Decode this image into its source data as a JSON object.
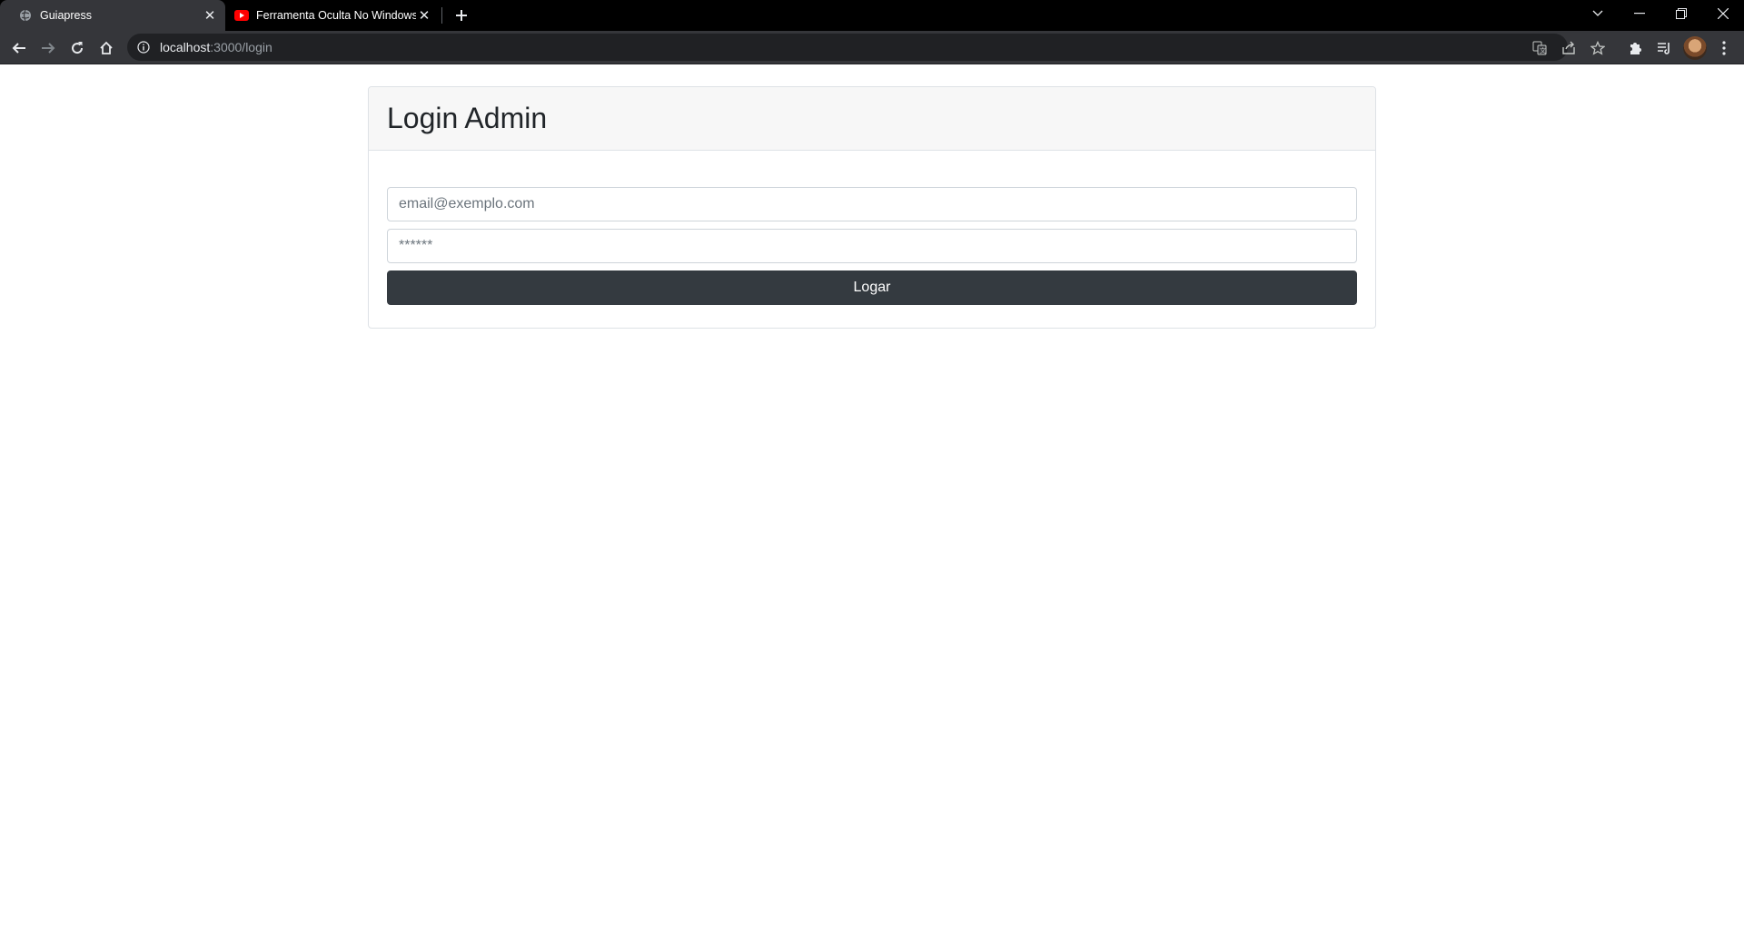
{
  "browser": {
    "tabs": [
      {
        "title": "Guiapress",
        "active": true,
        "favicon": "globe-icon"
      },
      {
        "title": "Ferramenta Oculta No Windows",
        "active": false,
        "favicon": "youtube-icon"
      }
    ],
    "address": {
      "host": "localhost",
      "path": ":3000/login"
    },
    "colors": {
      "tabstrip": "#000000",
      "toolbar": "#35363a",
      "omnibox": "#202124"
    }
  },
  "page": {
    "heading": "Login Admin",
    "email_placeholder": "email@exemplo.com",
    "password_placeholder": "******",
    "submit_label": "Logar",
    "colors": {
      "button": "#343a40",
      "header_bg": "#f7f7f7",
      "border": "#dee2e6"
    }
  }
}
